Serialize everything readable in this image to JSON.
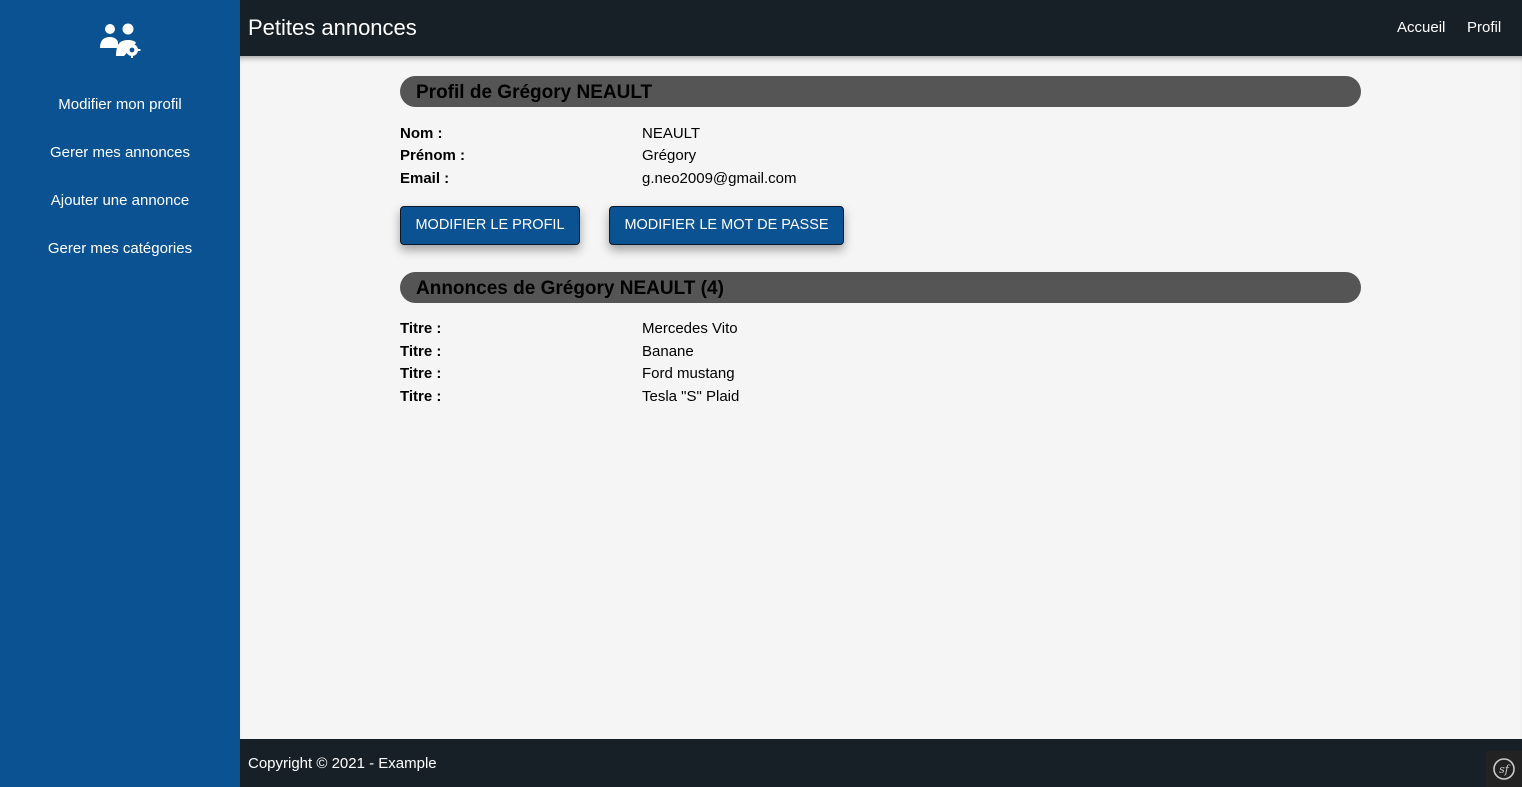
{
  "app": {
    "title": "Petites annonces"
  },
  "topnav": {
    "home": "Accueil",
    "profile": "Profil"
  },
  "sidebar": {
    "logo_icon": "users-gear-icon",
    "items": [
      {
        "label": "Modifier mon profil"
      },
      {
        "label": "Gerer mes annonces"
      },
      {
        "label": "Ajouter une annonce"
      },
      {
        "label": "Gerer mes catégories"
      }
    ]
  },
  "profile": {
    "heading": "Profil de Grégory NEAULT",
    "fields": [
      {
        "label": "Nom :",
        "value": "NEAULT"
      },
      {
        "label": "Prénom :",
        "value": "Grégory"
      },
      {
        "label": "Email :",
        "value": "g.neo2009@gmail.com"
      }
    ],
    "edit_profile_button": "MODIFIER LE PROFIL",
    "edit_password_button": "MODIFIER LE MOT DE PASSE"
  },
  "ads": {
    "heading": "Annonces de Grégory NEAULT (4)",
    "items": [
      {
        "label": "Titre :",
        "value": "Mercedes Vito"
      },
      {
        "label": "Titre :",
        "value": "Banane"
      },
      {
        "label": "Titre :",
        "value": "Ford mustang"
      },
      {
        "label": "Titre :",
        "value": "Tesla \"S\" Plaid"
      }
    ]
  },
  "footer": {
    "copyright": "Copyright © 2021 - Example",
    "badge_icon": "symfony-icon"
  },
  "colors": {
    "sidebar": "#0a5292",
    "topbar": "#172026",
    "header_bar": "#555555",
    "button": "#0a5292"
  }
}
